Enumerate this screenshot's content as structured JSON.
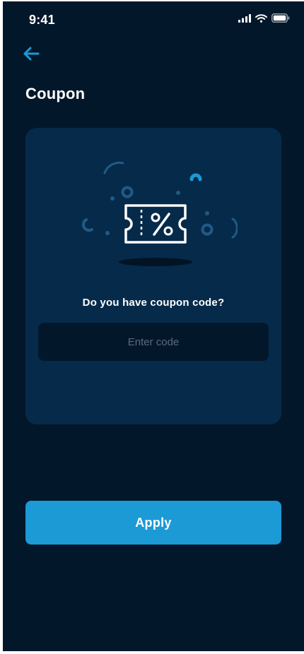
{
  "status_bar": {
    "time": "9:41",
    "icons": [
      "cellular-signal-icon",
      "wifi-icon",
      "battery-icon"
    ]
  },
  "header": {
    "back_icon": "arrow-left-icon",
    "title": "Coupon"
  },
  "coupon_card": {
    "illustration_icon": "coupon-ticket-percent-icon",
    "question": "Do you have coupon code?",
    "code_input": {
      "value": "",
      "placeholder": "Enter code"
    }
  },
  "apply_button": {
    "label": "Apply"
  },
  "colors": {
    "background": "#03172b",
    "card": "#062a4a",
    "accent": "#1b9ad6",
    "text": "#ffffff",
    "placeholder": "#5a6b7c"
  }
}
